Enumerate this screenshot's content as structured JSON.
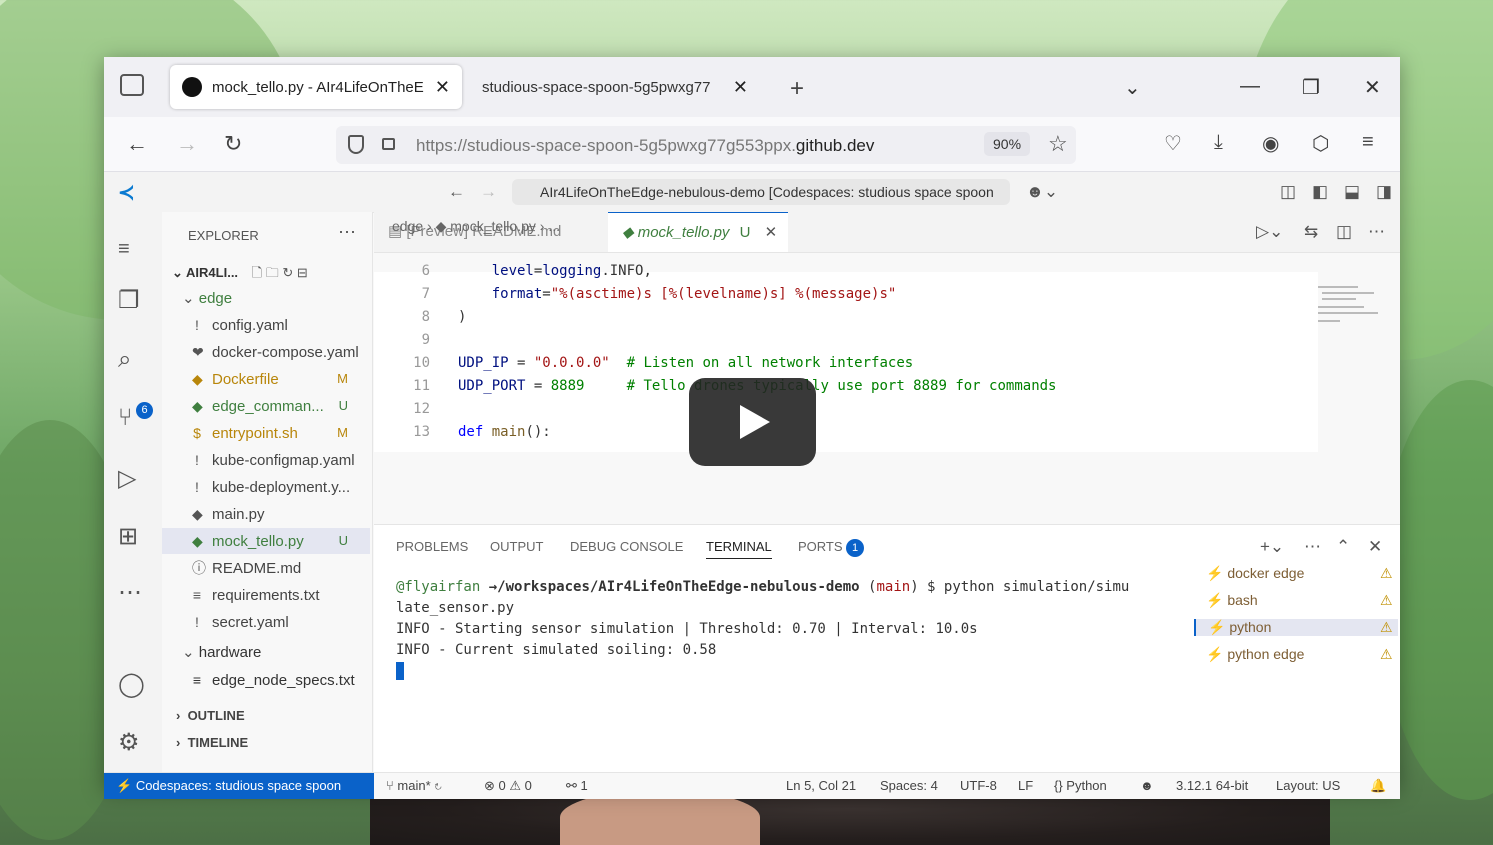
{
  "browser": {
    "tabs": [
      {
        "title": "mock_tello.py - AIr4LifeOnTheE"
      },
      {
        "title": "studious-space-spoon-5g5pwxg77"
      }
    ],
    "url_prefix": "https://studious-space-spoon-5g5pwxg77g553ppx.",
    "url_domain": "github.dev",
    "zoom": "90%"
  },
  "vscode": {
    "command_center": "AIr4LifeOnTheEdge-nebulous-demo [Codespaces: studious space spoon",
    "explorer": {
      "title": "EXPLORER",
      "root": "AIR4LI...",
      "folder_edge": "edge",
      "files": [
        {
          "name": "config.yaml",
          "icon": "!",
          "color": "#555",
          "status": ""
        },
        {
          "name": "docker-compose.yaml",
          "icon": "❤",
          "color": "#555",
          "status": ""
        },
        {
          "name": "Dockerfile",
          "icon": "◆",
          "color": "#b8860b",
          "status": "M"
        },
        {
          "name": "edge_comman...",
          "icon": "◆",
          "color": "#3f7f3f",
          "status": "U"
        },
        {
          "name": "entrypoint.sh",
          "icon": "$",
          "color": "#b8860b",
          "status": "M"
        },
        {
          "name": "kube-configmap.yaml",
          "icon": "!",
          "color": "#555",
          "status": ""
        },
        {
          "name": "kube-deployment.y...",
          "icon": "!",
          "color": "#555",
          "status": ""
        },
        {
          "name": "main.py",
          "icon": "◆",
          "color": "#555",
          "status": ""
        },
        {
          "name": "mock_tello.py",
          "icon": "◆",
          "color": "#3f7f3f",
          "status": "U"
        },
        {
          "name": "README.md",
          "icon": "ⓘ",
          "color": "#555",
          "status": ""
        },
        {
          "name": "requirements.txt",
          "icon": "≡",
          "color": "#555",
          "status": ""
        },
        {
          "name": "secret.yaml",
          "icon": "!",
          "color": "#555",
          "status": ""
        }
      ],
      "folder_hardware": "hardware",
      "hardware_files": [
        {
          "name": "edge_node_specs.txt"
        }
      ],
      "outline": "OUTLINE",
      "timeline": "TIMELINE"
    },
    "editor_tabs": {
      "preview": "[Preview] README.md",
      "active": "mock_tello.py",
      "active_status": "U"
    },
    "breadcrumb": {
      "folder": "edge",
      "file": "mock_tello.py",
      "tail": "..."
    },
    "code": [
      {
        "n": "6",
        "text": "    level=logging.INFO,"
      },
      {
        "n": "7",
        "text": "    format=\"%(asctime)s [%(levelname)s] %(message)s\""
      },
      {
        "n": "8",
        "text": ")"
      },
      {
        "n": "9",
        "text": ""
      },
      {
        "n": "10",
        "text": "UDP_IP = \"0.0.0.0\"  # Listen on all network interfaces"
      },
      {
        "n": "11",
        "text": "UDP_PORT = 8889     # Tello drones typically use port 8889 for commands"
      },
      {
        "n": "12",
        "text": ""
      },
      {
        "n": "13",
        "text": "def main():"
      }
    ],
    "panel": {
      "tabs": [
        "PROBLEMS",
        "OUTPUT",
        "DEBUG CONSOLE",
        "TERMINAL",
        "PORTS"
      ],
      "ports_badge": "1",
      "terminal_lines": [
        "@flyairfan →/workspaces/AIr4LifeOnTheEdge-nebulous-demo (main) $ python simulation/simu",
        "late_sensor.py",
        "INFO - Starting sensor simulation | Threshold: 0.70 | Interval: 10.0s",
        "INFO - Current simulated soiling: 0.58"
      ],
      "terminals": [
        {
          "name": "docker edge"
        },
        {
          "name": "bash"
        },
        {
          "name": "python"
        },
        {
          "name": "python edge"
        }
      ]
    },
    "statusbar": {
      "remote": "Codespaces: studious space spoon",
      "branch": "main*",
      "errors": "0",
      "warnings": "0",
      "ports": "1",
      "position": "Ln 5, Col 21",
      "spaces": "Spaces: 4",
      "encoding": "UTF-8",
      "eol": "LF",
      "language": "Python",
      "interpreter": "3.12.1 64-bit",
      "layout": "Layout: US"
    }
  }
}
